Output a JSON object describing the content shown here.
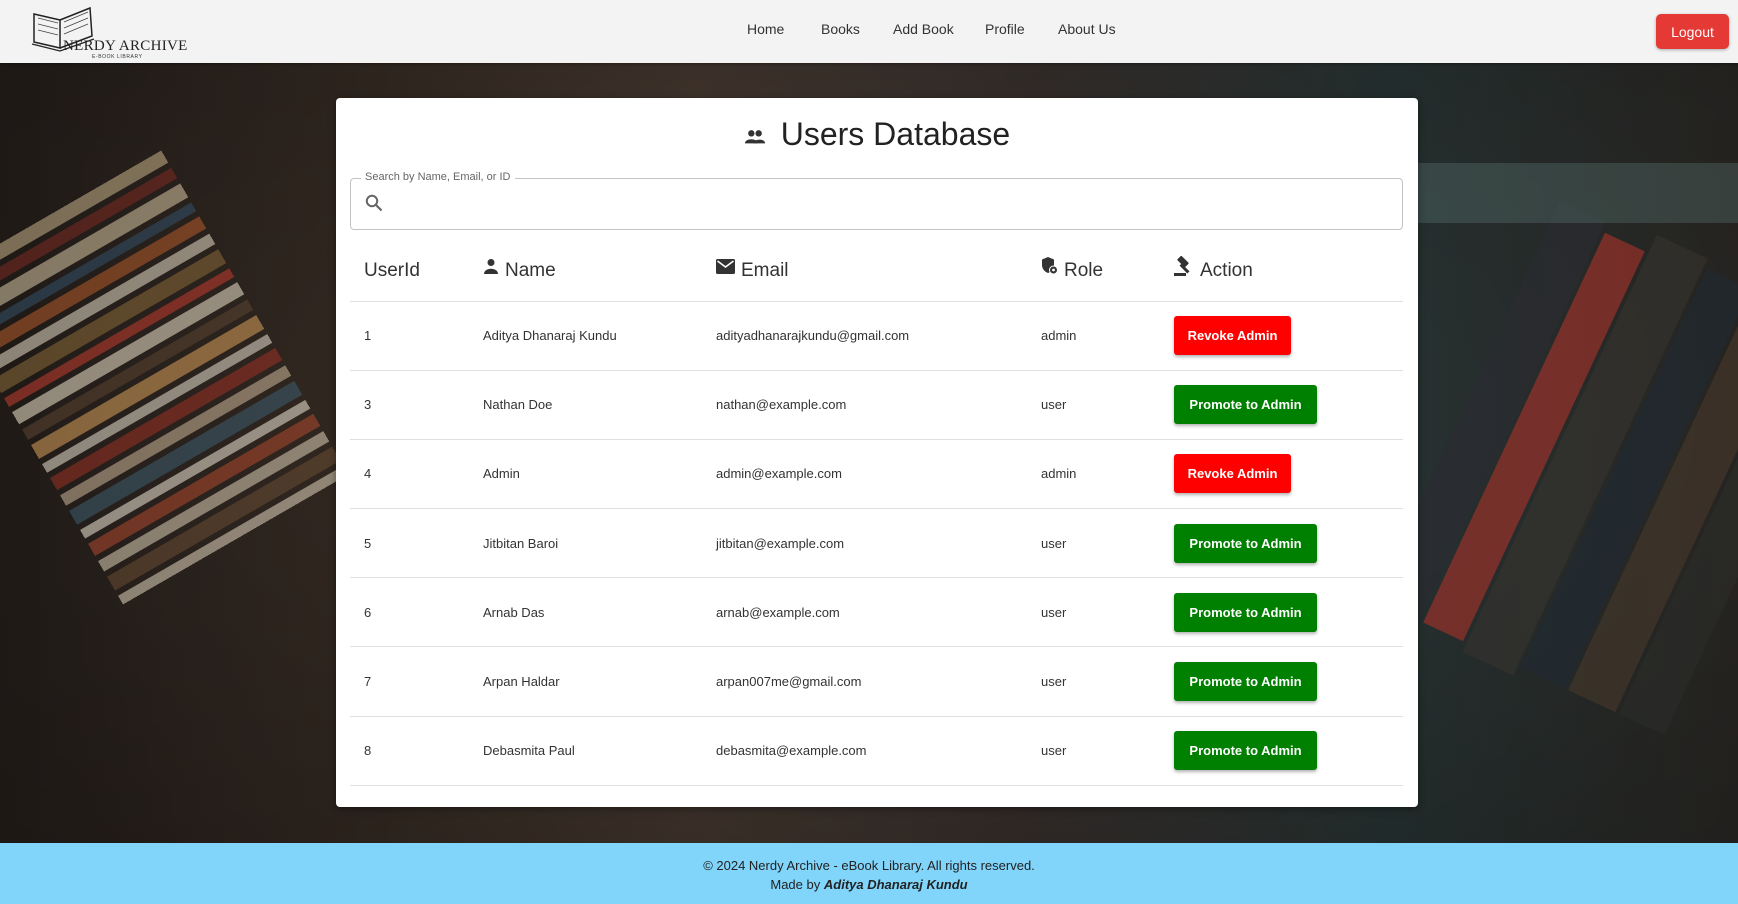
{
  "nav": {
    "logo_title": "NERDY ARCHIVE",
    "logo_subtitle": "E-BOOK LIBRARY",
    "links": [
      "Home",
      "Books",
      "Add Book",
      "Profile",
      "About Us"
    ],
    "logout_label": "Logout",
    "logout_color": "#e53935"
  },
  "page": {
    "title": "Users Database",
    "title_icon": "people-icon"
  },
  "search": {
    "label": "Search by Name, Email, or ID",
    "value": "",
    "icon": "search-icon"
  },
  "table": {
    "headers": [
      {
        "label": "UserId",
        "icon": ""
      },
      {
        "label": "Name",
        "icon": "person-icon"
      },
      {
        "label": "Email",
        "icon": "mail-icon"
      },
      {
        "label": "Role",
        "icon": "admin-shield-icon"
      },
      {
        "label": "Action",
        "icon": "gavel-icon"
      }
    ],
    "rows": [
      {
        "id": "1",
        "name": "Aditya Dhanaraj Kundu",
        "email": "adityadhanarajkundu@gmail.com",
        "role": "admin",
        "action": "Revoke Admin"
      },
      {
        "id": "3",
        "name": "Nathan Doe",
        "email": "nathan@example.com",
        "role": "user",
        "action": "Promote to Admin"
      },
      {
        "id": "4",
        "name": "Admin",
        "email": "admin@example.com",
        "role": "admin",
        "action": "Revoke Admin"
      },
      {
        "id": "5",
        "name": "Jitbitan Baroi",
        "email": "jitbitan@example.com",
        "role": "user",
        "action": "Promote to Admin"
      },
      {
        "id": "6",
        "name": "Arnab Das",
        "email": "arnab@example.com",
        "role": "user",
        "action": "Promote to Admin"
      },
      {
        "id": "7",
        "name": "Arpan Haldar",
        "email": "arpan007me@gmail.com",
        "role": "user",
        "action": "Promote to Admin"
      },
      {
        "id": "8",
        "name": "Debasmita Paul",
        "email": "debasmita@example.com",
        "role": "user",
        "action": "Promote to Admin"
      }
    ]
  },
  "colors": {
    "revoke": "#ff0000",
    "promote": "#008000",
    "footer_bg": "#81d4fa"
  },
  "footer": {
    "copyright": "© 2024 Nerdy Archive - eBook Library. All rights reserved.",
    "made_by_prefix": "Made by",
    "author": "Aditya Dhanaraj Kundu"
  }
}
